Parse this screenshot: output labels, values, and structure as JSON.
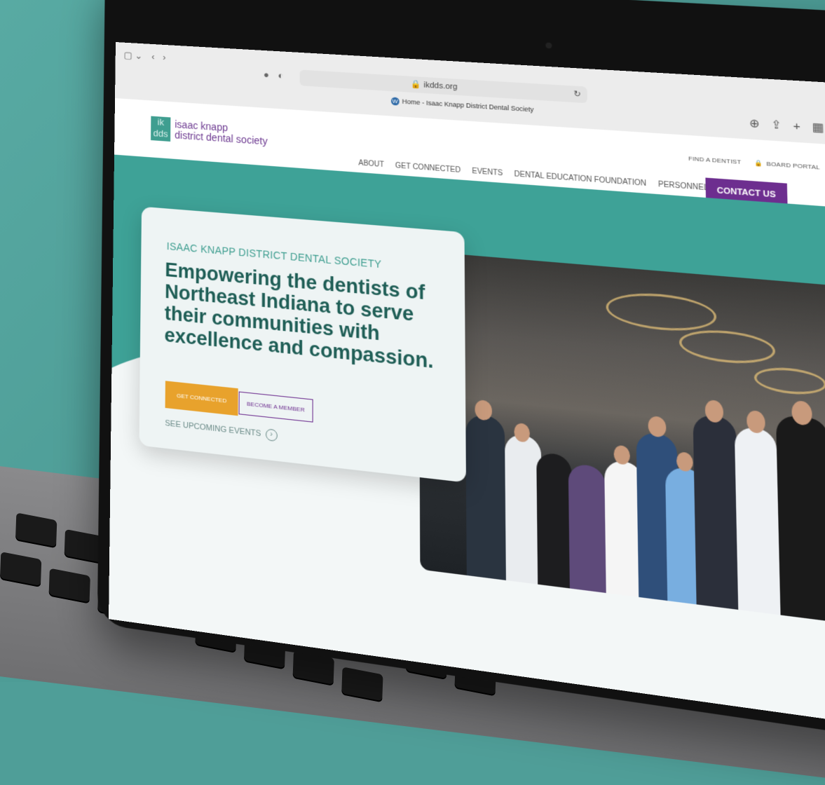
{
  "browser": {
    "url": "ikdds.org",
    "tab_title": "Home - Isaac Knapp District Dental Society"
  },
  "site": {
    "logo_mark_top": "ik",
    "logo_mark_bottom": "dds",
    "logo_line1": "isaac knapp",
    "logo_line2": "district dental society",
    "utility": {
      "find": "FIND A DENTIST",
      "portal": "BOARD PORTAL"
    },
    "nav": [
      "ABOUT",
      "GET CONNECTED",
      "EVENTS",
      "DENTAL EDUCATION FOUNDATION",
      "PERSONNEL SERVICE"
    ],
    "cta": "CONTACT US"
  },
  "hero": {
    "kicker": "ISAAC KNAPP DISTRICT DENTAL SOCIETY",
    "headline": "Empowering the dentists of Northeast Indiana to serve their communities with excellence and compassion.",
    "btn_primary": "GET CONNECTED",
    "btn_secondary": "BECOME A MEMBER",
    "events_link": "SEE UPCOMING EVENTS"
  },
  "colors": {
    "teal": "#3ea297",
    "purple": "#6d2e8f",
    "orange": "#e8a22c",
    "dark_teal": "#1f5e56"
  }
}
